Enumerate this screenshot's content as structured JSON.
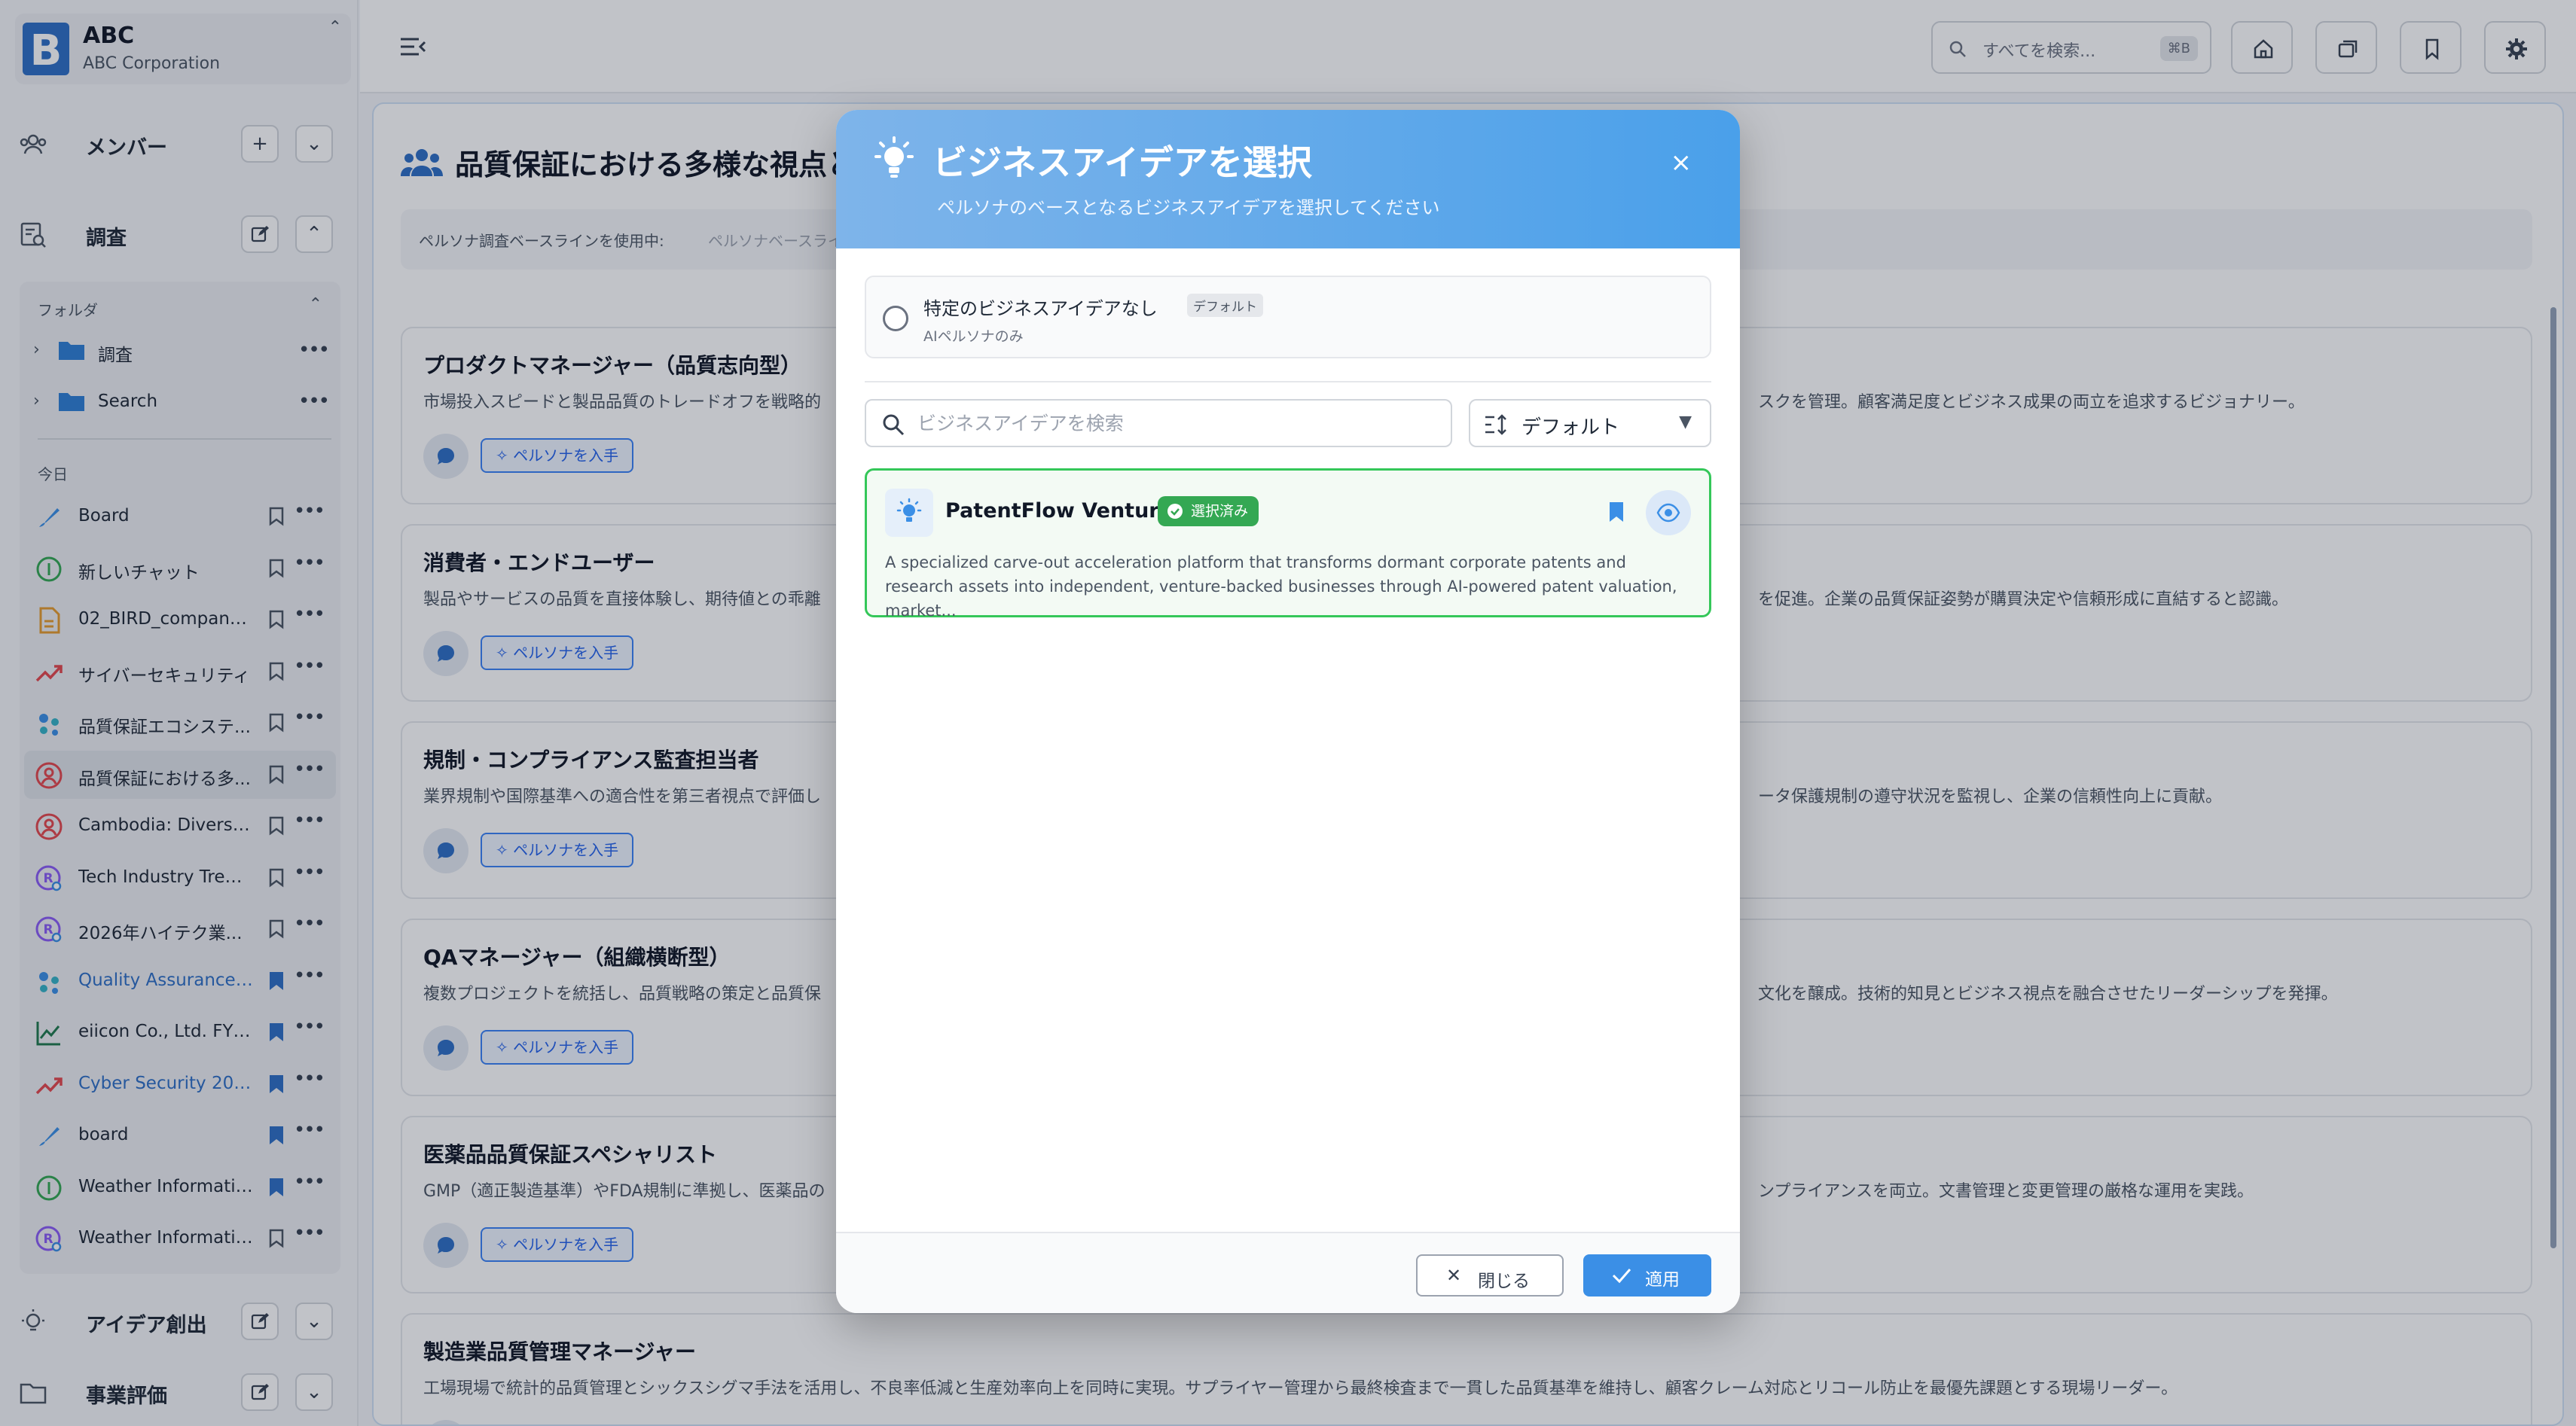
{
  "org": {
    "name": "ABC",
    "subtitle": "ABC Corporation",
    "logo_letter": "B"
  },
  "sidebar": {
    "sections": {
      "members": "メンバー",
      "research": "調査",
      "ideation": "アイデア創出",
      "evaluation": "事業評価"
    },
    "folder_header": "フォルダ",
    "folders": [
      "調査",
      "Search"
    ],
    "today_label": "今日",
    "items": [
      {
        "label": "Board",
        "icon": "brush-icon",
        "bookmarked": false
      },
      {
        "label": "新しいチャット",
        "icon": "chat-circle-icon",
        "bookmarked": false
      },
      {
        "label": "02_BIRD_company_...",
        "icon": "document-icon",
        "bookmarked": false
      },
      {
        "label": "サイバーセキュリティ",
        "icon": "trend-icon",
        "bookmarked": false
      },
      {
        "label": "品質保証エコシステ...",
        "icon": "persona-group-icon",
        "bookmarked": false
      },
      {
        "label": "品質保証における多...",
        "icon": "persona-icon",
        "bookmarked": false,
        "active": true
      },
      {
        "label": "Cambodia: Diverse ...",
        "icon": "persona-icon",
        "bookmarked": false
      },
      {
        "label": "Tech Industry Trend...",
        "icon": "research-icon",
        "bookmarked": false
      },
      {
        "label": "2026年ハイテク業...",
        "icon": "research-icon",
        "bookmarked": false
      },
      {
        "label": "Quality Assurance ...",
        "icon": "persona-group-icon",
        "bookmarked": true,
        "blue": true
      },
      {
        "label": "eiicon Co., Ltd. FY2...",
        "icon": "line-chart-icon",
        "bookmarked": true
      },
      {
        "label": "Cyber Security 2026",
        "icon": "trend-icon",
        "bookmarked": true,
        "blue": true
      },
      {
        "label": "board",
        "icon": "brush-icon",
        "bookmarked": true
      },
      {
        "label": "Weather Informatio...",
        "icon": "chat-circle-icon",
        "bookmarked": true
      },
      {
        "label": "Weather Informatio...",
        "icon": "research-icon",
        "bookmarked": false
      }
    ]
  },
  "topbar": {
    "search_placeholder": "すべてを検索...",
    "shortcut": "⌘B"
  },
  "main": {
    "title": "品質保証における多様な視点と",
    "baseline_label": "ペルソナ調査ベースラインを使用中:",
    "baseline_value": "ペルソナベースライ",
    "get_persona": "ペルソナを入手",
    "cards": [
      {
        "title": "プロダクトマネージャー（品質志向型）",
        "desc": "市場投入スピードと製品品質のトレードオフを戦略的",
        "desc_right": "スクを管理。顧客満足度とビジネス成果の両立を追求するビジョナリー。"
      },
      {
        "title": "消費者・エンドユーザー",
        "desc": "製品やサービスの品質を直接体験し、期待値との乖離",
        "desc_right": "を促進。企業の品質保証姿勢が購買決定や信頼形成に直結すると認識。"
      },
      {
        "title": "規制・コンプライアンス監査担当者",
        "desc": "業界規制や国際基準への適合性を第三者視点で評価し",
        "desc_right": "ータ保護規制の遵守状況を監視し、企業の信頼性向上に貢献。"
      },
      {
        "title": "QAマネージャー（組織横断型）",
        "desc": "複数プロジェクトを統括し、品質戦略の策定と品質保",
        "desc_right": "文化を醸成。技術的知見とビジネス視点を融合させたリーダーシップを発揮。"
      },
      {
        "title": "医薬品品質保証スペシャリスト",
        "desc": "GMP（適正製造基準）やFDA規制に準拠し、医薬品の",
        "desc_right": "ンプライアンスを両立。文書管理と変更管理の厳格な運用を実践。"
      },
      {
        "title": "製造業品質管理マネージャー",
        "desc": "工場現場で統計的品質管理とシックスシグマ手法を活用し、不良率低減と生産効率向上を同時に実現。サプライヤー管理から最終検査まで一貫した品質基準を維持し、顧客クレーム対応とリコール防止を最優先課題とする現場リーダー。",
        "desc_right": ""
      }
    ]
  },
  "modal": {
    "title": "ビジネスアイデアを選択",
    "subtitle": "ペルソナのベースとなるビジネスアイデアを選択してください",
    "close_icon": "×",
    "none_option": {
      "title": "特定のビジネスアイデアなし",
      "badge": "デフォルト",
      "sub": "AIペルソナのみ"
    },
    "search_placeholder": "ビジネスアイデアを検索",
    "sort_label": "デフォルト",
    "idea": {
      "title": "PatentFlow Ventures",
      "badge": "選択済み",
      "desc": "A specialized carve-out acceleration platform that transforms dormant corporate patents and research assets into independent, venture-backed businesses through AI-powered patent valuation, market..."
    },
    "close_button": "閉じる",
    "apply_button": "適用"
  },
  "colors": {
    "accent": "#3b8fe6",
    "selected": "#34c759",
    "header_from": "#7eb4ea",
    "header_to": "#4aa0ea"
  }
}
